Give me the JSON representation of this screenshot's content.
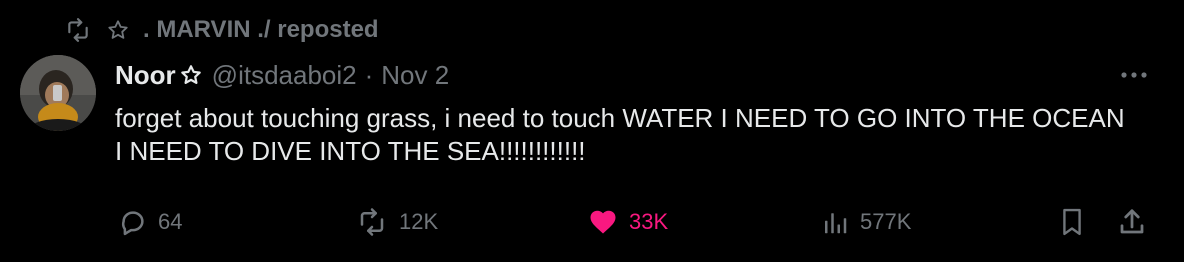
{
  "repost": {
    "text": ". MARVIN ./ reposted",
    "icon": "repost-icon",
    "star_icon": "star-outline-icon"
  },
  "author": {
    "display_name": "Noor",
    "name_badge_icon": "star-outline-icon",
    "handle": "@itsdaaboi2",
    "separator": "·",
    "date": "Nov 2"
  },
  "tweet": {
    "text": "forget about touching grass, i need to touch WATER I NEED TO GO INTO THE OCEAN I NEED TO DIVE INTO THE SEA!!!!!!!!!!!!"
  },
  "actions": {
    "replies": "64",
    "reposts": "12K",
    "likes": "33K",
    "views": "577K"
  },
  "colors": {
    "background": "#000000",
    "text": "#e7e9ea",
    "muted": "#71767b",
    "like": "#f91880"
  }
}
